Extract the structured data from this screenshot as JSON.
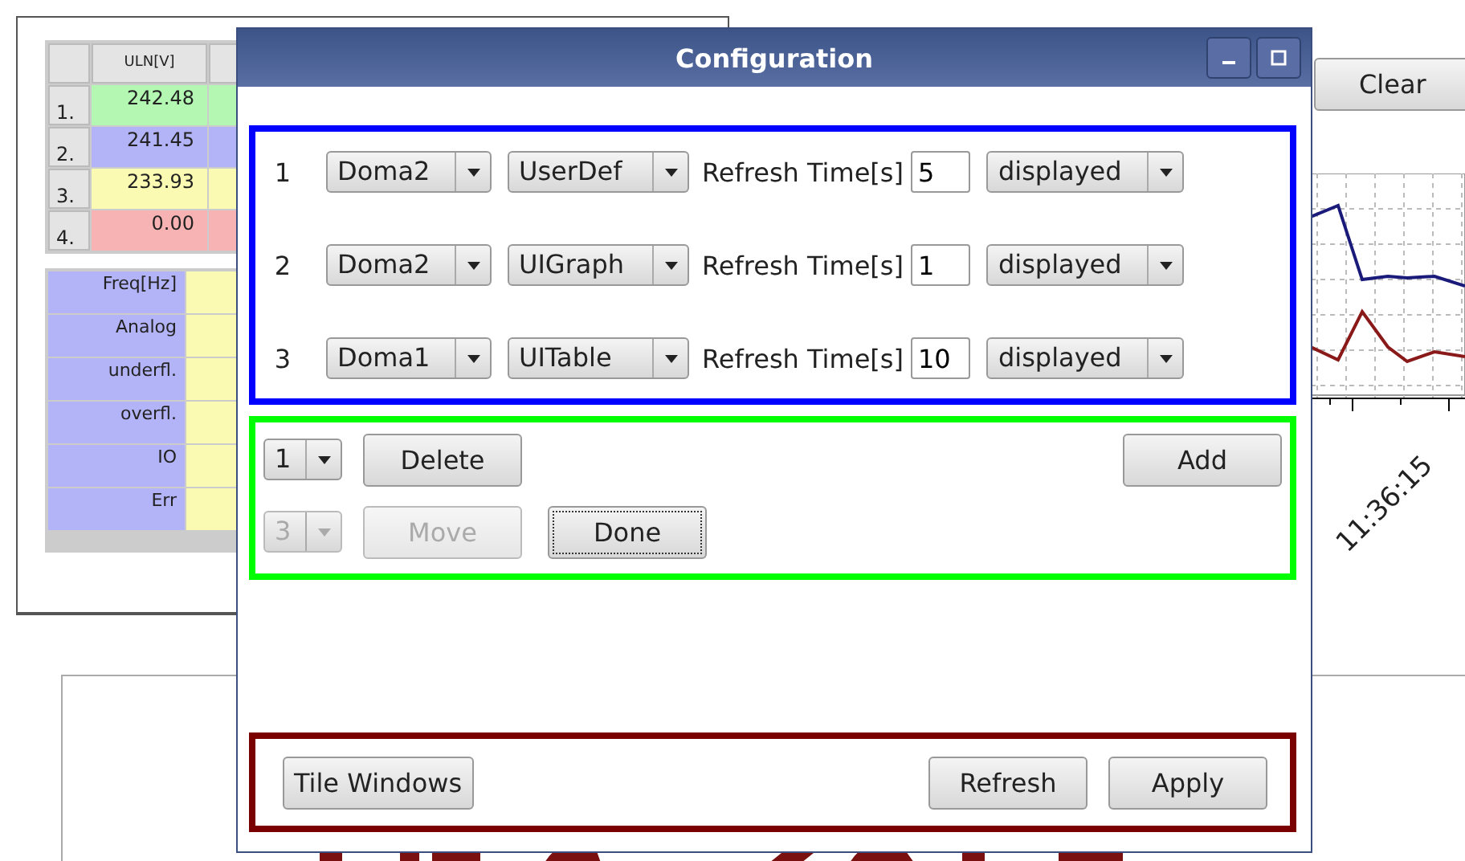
{
  "background_window": {
    "table": {
      "columns": [
        "ULN[V]"
      ],
      "rows": [
        {
          "index": "1.",
          "value": "242.48",
          "color": "#b3f7b3"
        },
        {
          "index": "2.",
          "value": "241.45",
          "color": "#b3b3f7"
        },
        {
          "index": "3.",
          "value": "233.93",
          "color": "#fafab3"
        },
        {
          "index": "4.",
          "value": "0.00",
          "color": "#f7b3b3"
        }
      ]
    },
    "info_table": {
      "rows": [
        "Freq[Hz]",
        "Analog",
        "underfl.",
        "overfl.",
        "IO",
        "Err"
      ]
    }
  },
  "chart_window": {
    "button": "Clear",
    "time_label": "11:36:15"
  },
  "dialog": {
    "title": "Configuration",
    "views": [
      {
        "number": "1",
        "source": "Doma2",
        "type": "UserDef",
        "refresh_label": "Refresh Time[s]",
        "refresh_value": "5",
        "visibility": "displayed"
      },
      {
        "number": "2",
        "source": "Doma2",
        "type": "UIGraph",
        "refresh_label": "Refresh Time[s]",
        "refresh_value": "1",
        "visibility": "displayed"
      },
      {
        "number": "3",
        "source": "Doma1",
        "type": "UITable",
        "refresh_label": "Refresh Time[s]",
        "refresh_value": "10",
        "visibility": "displayed"
      }
    ],
    "edit": {
      "row_select": {
        "value": "1",
        "disabled": false
      },
      "delete": {
        "label": "Delete",
        "disabled": false
      },
      "add": {
        "label": "Add",
        "disabled": false
      },
      "move_select": {
        "value": "3",
        "disabled": true
      },
      "move": {
        "label": "Move",
        "disabled": true
      },
      "done": {
        "label": "Done",
        "disabled": false,
        "focused": true
      }
    },
    "footer": {
      "tile": "Tile Windows",
      "refresh": "Refresh",
      "apply": "Apply"
    }
  }
}
